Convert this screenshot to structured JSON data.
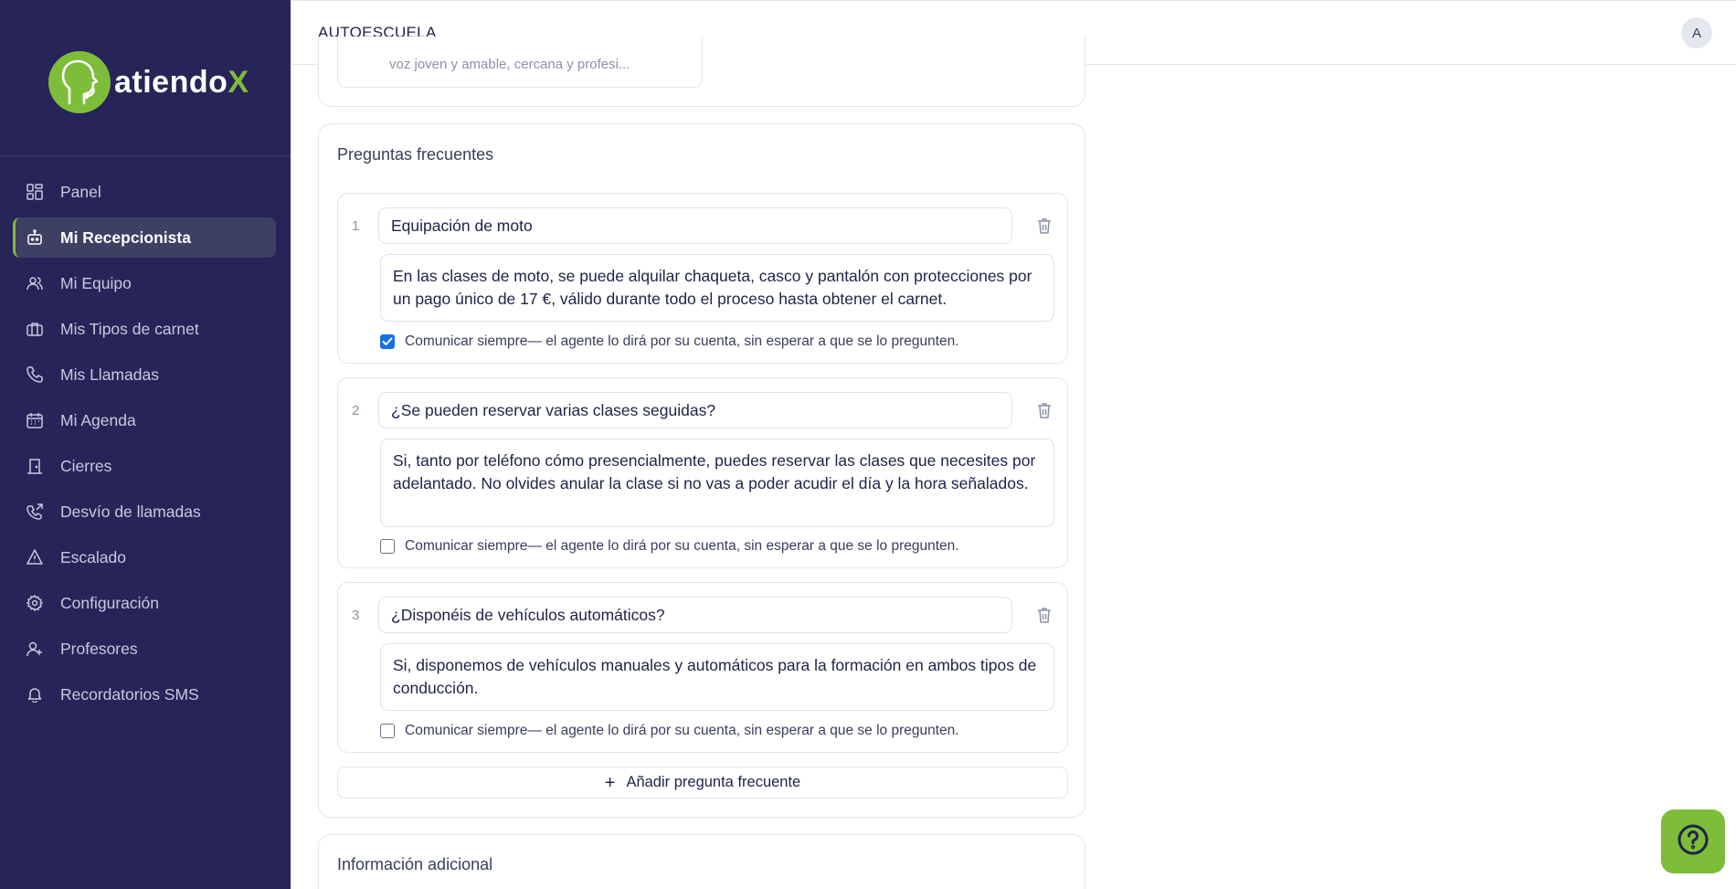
{
  "brand": {
    "name_main": "atiendo",
    "name_accent": "X"
  },
  "sidebar": {
    "items": [
      {
        "label": "Panel",
        "icon": "dashboard-icon"
      },
      {
        "label": "Mi Recepcionista",
        "icon": "robot-icon",
        "active": true
      },
      {
        "label": "Mi Equipo",
        "icon": "users-icon"
      },
      {
        "label": "Mis Tipos de carnet",
        "icon": "briefcase-icon"
      },
      {
        "label": "Mis Llamadas",
        "icon": "phone-icon"
      },
      {
        "label": "Mi Agenda",
        "icon": "calendar-icon"
      },
      {
        "label": "Cierres",
        "icon": "door-icon"
      },
      {
        "label": "Desvío de llamadas",
        "icon": "phone-forward-icon"
      },
      {
        "label": "Escalado",
        "icon": "warning-icon"
      },
      {
        "label": "Configuración",
        "icon": "gear-icon"
      },
      {
        "label": "Profesores",
        "icon": "user-plus-icon"
      },
      {
        "label": "Recordatorios SMS",
        "icon": "bell-icon"
      }
    ]
  },
  "header": {
    "company": "AUTOESCUELA",
    "avatar_initial": "A"
  },
  "voice": {
    "snippet": "voz joven y amable, cercana y profesi..."
  },
  "faq": {
    "title": "Preguntas frecuentes",
    "items": [
      {
        "number": "1",
        "question": "Equipación de moto",
        "answer": "En las clases de moto, se puede alquilar chaqueta, casco y pantalón con protecciones por un pago único de 17 €, válido durante todo el proceso hasta obtener el carnet.",
        "always_label": "Comunicar siempre",
        "always_desc": " — el agente lo dirá por su cuenta, sin esperar a que se lo pregunten.",
        "always": true
      },
      {
        "number": "2",
        "question": "¿Se pueden reservar varias clases seguidas?",
        "answer": "Si, tanto por teléfono cómo presencialmente, puedes reservar las clases que necesites por adelantado. No olvides anular la clase si no vas a poder acudir el día y la hora señalados.",
        "always_label": "Comunicar siempre",
        "always_desc": " — el agente lo dirá por su cuenta, sin esperar a que se lo pregunten.",
        "always": false
      },
      {
        "number": "3",
        "question": "¿Disponéis de vehículos automáticos?",
        "answer": "Si, disponemos de vehículos manuales y automáticos para la formación en ambos tipos de conducción.",
        "always_label": "Comunicar siempre",
        "always_desc": " — el agente lo dirá por su cuenta, sin esperar a que se lo pregunten.",
        "always": false
      }
    ],
    "add_label": "Añadir pregunta frecuente"
  },
  "extra": {
    "title": "Información adicional"
  },
  "colors": {
    "sidebar": "#272459",
    "accent": "#7dbd3a",
    "checkbox": "#1a6fe0"
  }
}
